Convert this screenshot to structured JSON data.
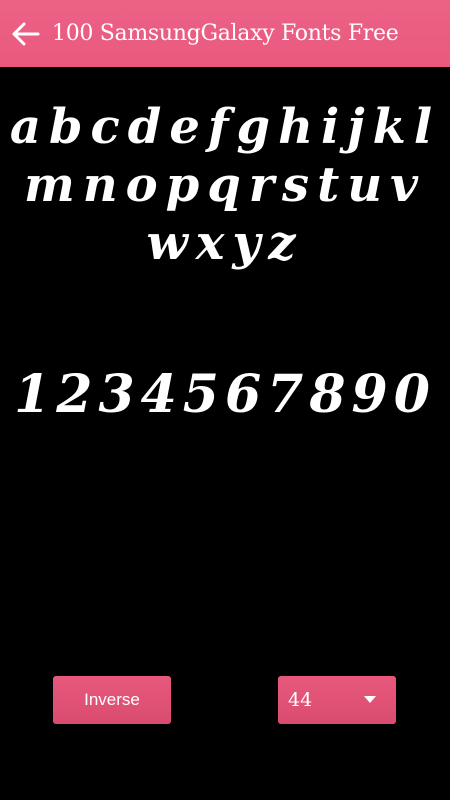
{
  "app_bar": {
    "title": "100 SamsungGalaxy Fonts Free",
    "back_icon": "arrow-left-icon",
    "color": "#ec6286"
  },
  "preview": {
    "letters": "abcdefghijklmnopqrstuvwxyz",
    "digits": "1234567890"
  },
  "controls": {
    "inverse_label": "Inverse",
    "size_value": "44",
    "dropdown_icon": "triangle-down-icon"
  },
  "colors": {
    "accent": "#e9597e",
    "background": "#000000",
    "text": "#ffffff"
  }
}
